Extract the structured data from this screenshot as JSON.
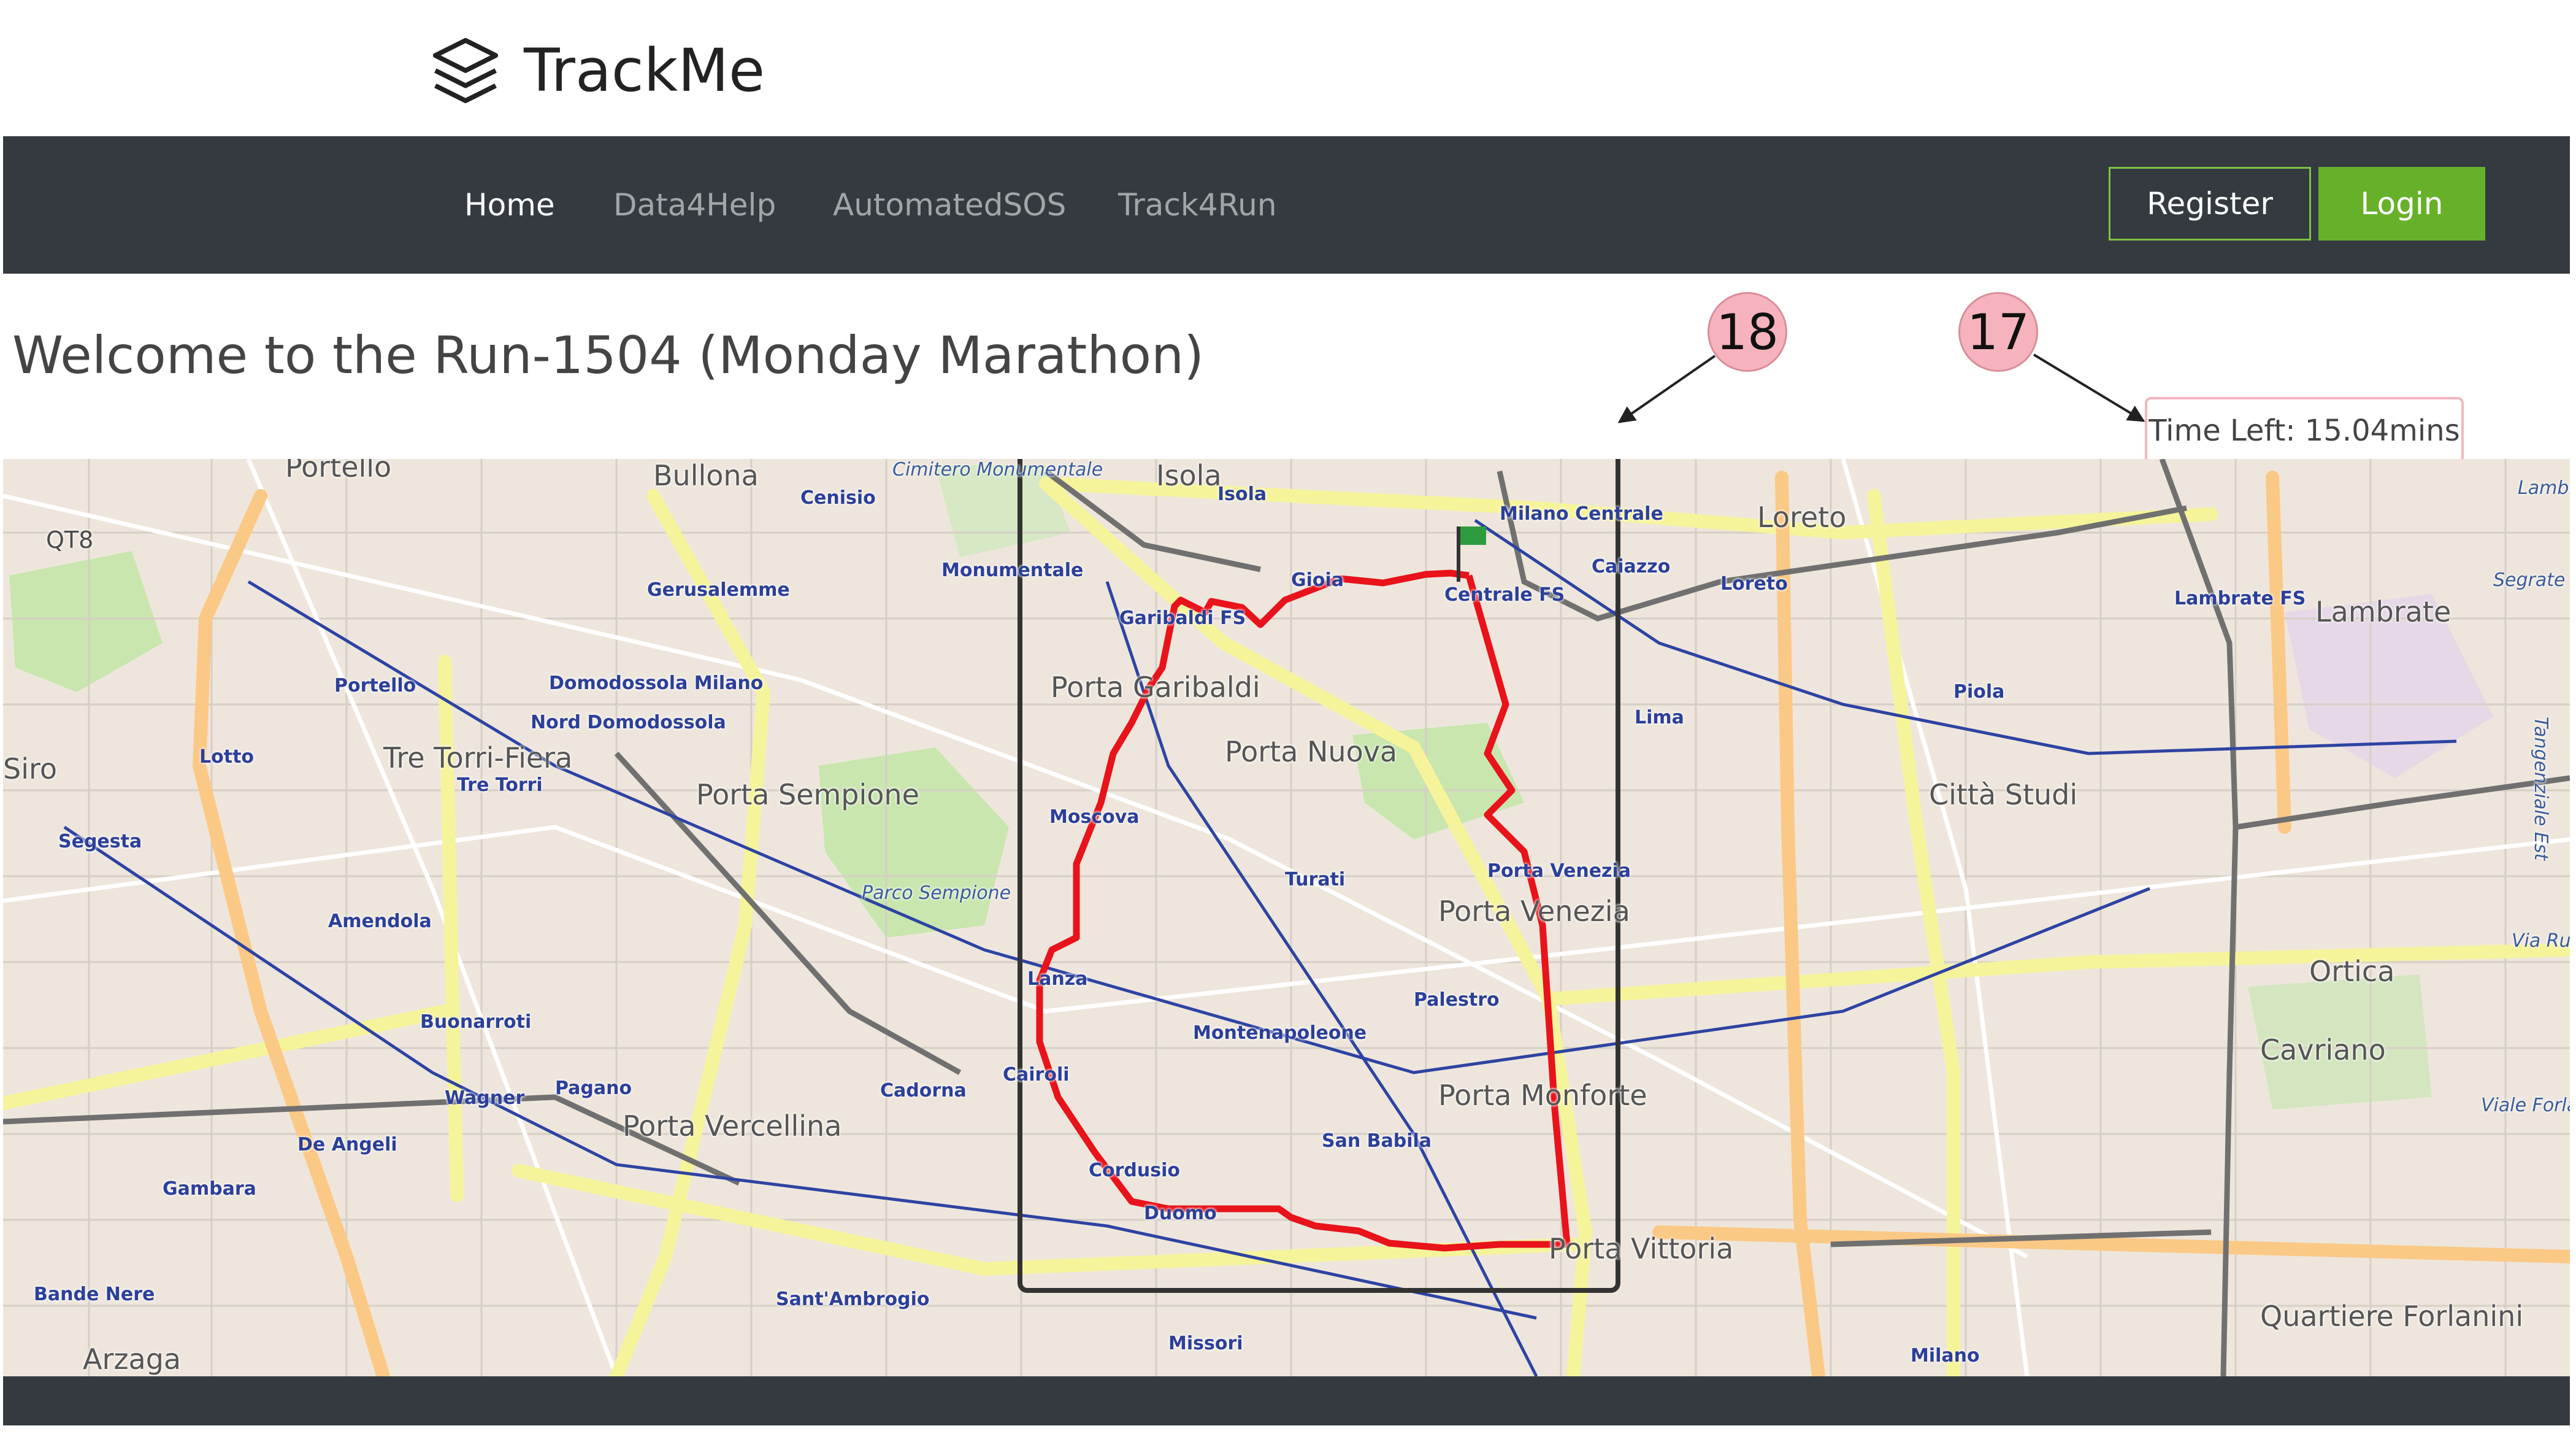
{
  "brand": {
    "name": "TrackMe",
    "icon": "layers-icon"
  },
  "nav": {
    "items": [
      {
        "label": "Home",
        "active": true
      },
      {
        "label": "Data4Help",
        "active": false
      },
      {
        "label": "AutomatedSOS",
        "active": false
      },
      {
        "label": "Track4Run",
        "active": false
      }
    ],
    "register_label": "Register",
    "login_label": "Login"
  },
  "page": {
    "title": "Welcome to the Run-1504 (Monday Marathon)"
  },
  "annotations": {
    "badge_a": "18",
    "badge_b": "17"
  },
  "time_left": "Time Left: 15.04mins",
  "map": {
    "labels_big": [
      "Porta Garibaldi",
      "Porta Nuova",
      "Porta Sempione",
      "Tre Torri-Fiera",
      "Porta Venezia",
      "Porta Monforte",
      "Porta Vercellina",
      "Città Studi",
      "Porta Vittoria",
      "Quartiere Forlanini",
      "Loreto",
      "Lambrate",
      "Ortica",
      "Cavriano",
      "Bullona",
      "Portello",
      "Isola",
      "Arzaga",
      "Siro"
    ],
    "labels_small": [
      "Isola",
      "Milano Centrale",
      "Gioia",
      "Centrale FS",
      "Garibaldi FS",
      "Monumentale",
      "Moscova",
      "Turati",
      "Porta Venezia",
      "Lima",
      "Caiazzo",
      "Loreto",
      "Lambrate FS",
      "Piola",
      "Palestro",
      "Montenapoleone",
      "San Babila",
      "Cordusio",
      "Duomo",
      "Cairoli",
      "Lanza",
      "Cadorna",
      "Pagano",
      "Wagner",
      "De Angeli",
      "Gambara",
      "Bande Nere",
      "Sant'Ambrogio",
      "Missori",
      "Milano",
      "Buonarroti",
      "Amendola",
      "Segesta",
      "Lotto",
      "Portello",
      "Gerusalemme",
      "Cenisio",
      "Domodossola Milano",
      "Nord Domodossola",
      "Tre Torri",
      "QT8"
    ],
    "labels_italic": [
      "Cimitero Monumentale",
      "Parco Sempione",
      "Segrate",
      "Via Rubattino",
      "Viale Forlanini",
      "Tangenziale Est",
      "Lambrate"
    ],
    "colors": {
      "route": "#e8131b",
      "major_road": "#f6f49a",
      "artery": "#fbc986",
      "metro": "#2d43a3",
      "park": "#c8e6ae",
      "base": "#eee6dc"
    }
  }
}
